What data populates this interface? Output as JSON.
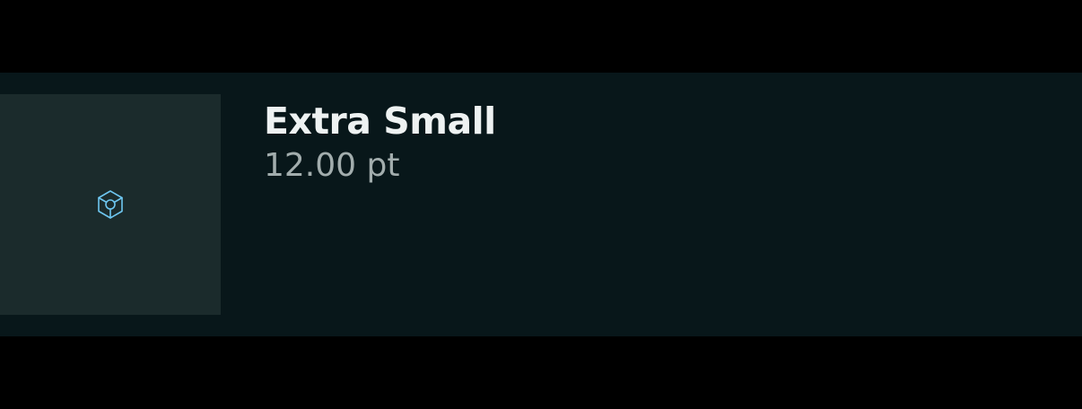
{
  "item": {
    "title": "Extra Small",
    "size_label": "12.00 pt",
    "icon": "cube-icon"
  },
  "colors": {
    "page_background": "#000000",
    "row_background": "#08171a",
    "thumbnail_background": "#1b2b2c",
    "title": "#eef2f2",
    "subtitle": "#a2adad",
    "icon_accent": "#6ec6f0"
  }
}
